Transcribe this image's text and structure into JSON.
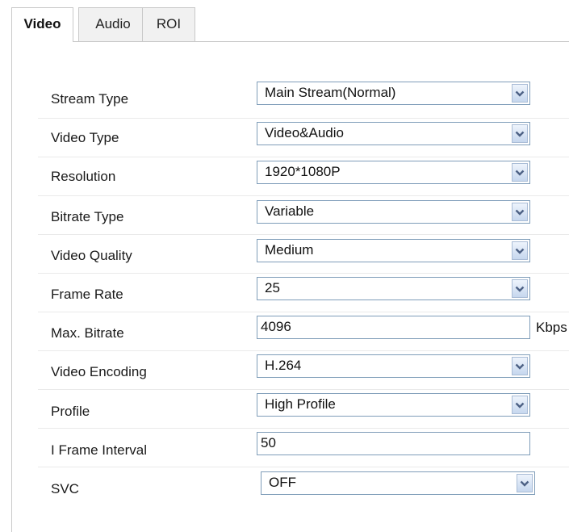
{
  "tabs": [
    {
      "label": "Video",
      "active": true
    },
    {
      "label": "Audio",
      "active": false
    },
    {
      "label": "ROI",
      "active": false
    }
  ],
  "form": {
    "stream_type": {
      "label": "Stream Type",
      "value": "Main Stream(Normal)"
    },
    "video_type": {
      "label": "Video Type",
      "value": "Video&Audio"
    },
    "resolution": {
      "label": "Resolution",
      "value": "1920*1080P"
    },
    "bitrate_type": {
      "label": "Bitrate Type",
      "value": "Variable"
    },
    "video_quality": {
      "label": "Video Quality",
      "value": "Medium"
    },
    "frame_rate": {
      "label": "Frame Rate",
      "value": "25"
    },
    "max_bitrate": {
      "label": "Max. Bitrate",
      "value": "4096",
      "unit": "Kbps"
    },
    "video_encoding": {
      "label": "Video Encoding",
      "value": "H.264"
    },
    "profile": {
      "label": "Profile",
      "value": "High Profile"
    },
    "i_frame_interval": {
      "label": "I Frame Interval",
      "value": "50"
    },
    "svc": {
      "label": "SVC",
      "value": "OFF"
    }
  },
  "icons": {
    "dropdown_arrow": "chevron-down-icon"
  },
  "colors": {
    "field_border": "#7f9db9",
    "arrow_color": "#4d6185",
    "tab_border": "#c9c9c9"
  }
}
